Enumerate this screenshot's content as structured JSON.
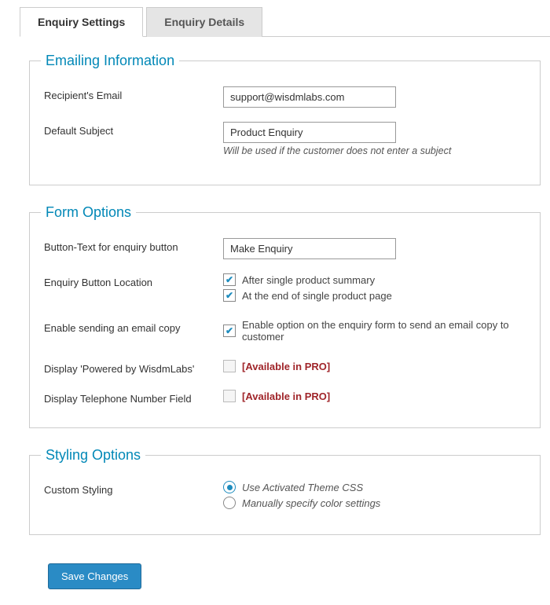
{
  "tabs": {
    "settings": "Enquiry Settings",
    "details": "Enquiry Details"
  },
  "emailing": {
    "legend": "Emailing Information",
    "recipient_label": "Recipient's Email",
    "recipient_value": "support@wisdmlabs.com",
    "subject_label": "Default Subject",
    "subject_value": "Product Enquiry",
    "subject_hint": "Will be used if the customer does not enter a subject"
  },
  "form": {
    "legend": "Form Options",
    "button_text_label": "Button-Text for enquiry button",
    "button_text_value": "Make Enquiry",
    "location_label": "Enquiry Button Location",
    "location_opt1": "After single product summary",
    "location_opt2": "At the end of single product page",
    "email_copy_label": "Enable sending an email copy",
    "email_copy_desc": "Enable option on the enquiry form to send an email copy to customer",
    "powered_label": "Display 'Powered by WisdmLabs'",
    "telephone_label": "Display Telephone Number Field",
    "pro_text": "[Available in PRO]"
  },
  "styling": {
    "legend": "Styling Options",
    "custom_label": "Custom Styling",
    "opt1": "Use Activated Theme CSS",
    "opt2": "Manually specify color settings"
  },
  "save_label": "Save Changes"
}
